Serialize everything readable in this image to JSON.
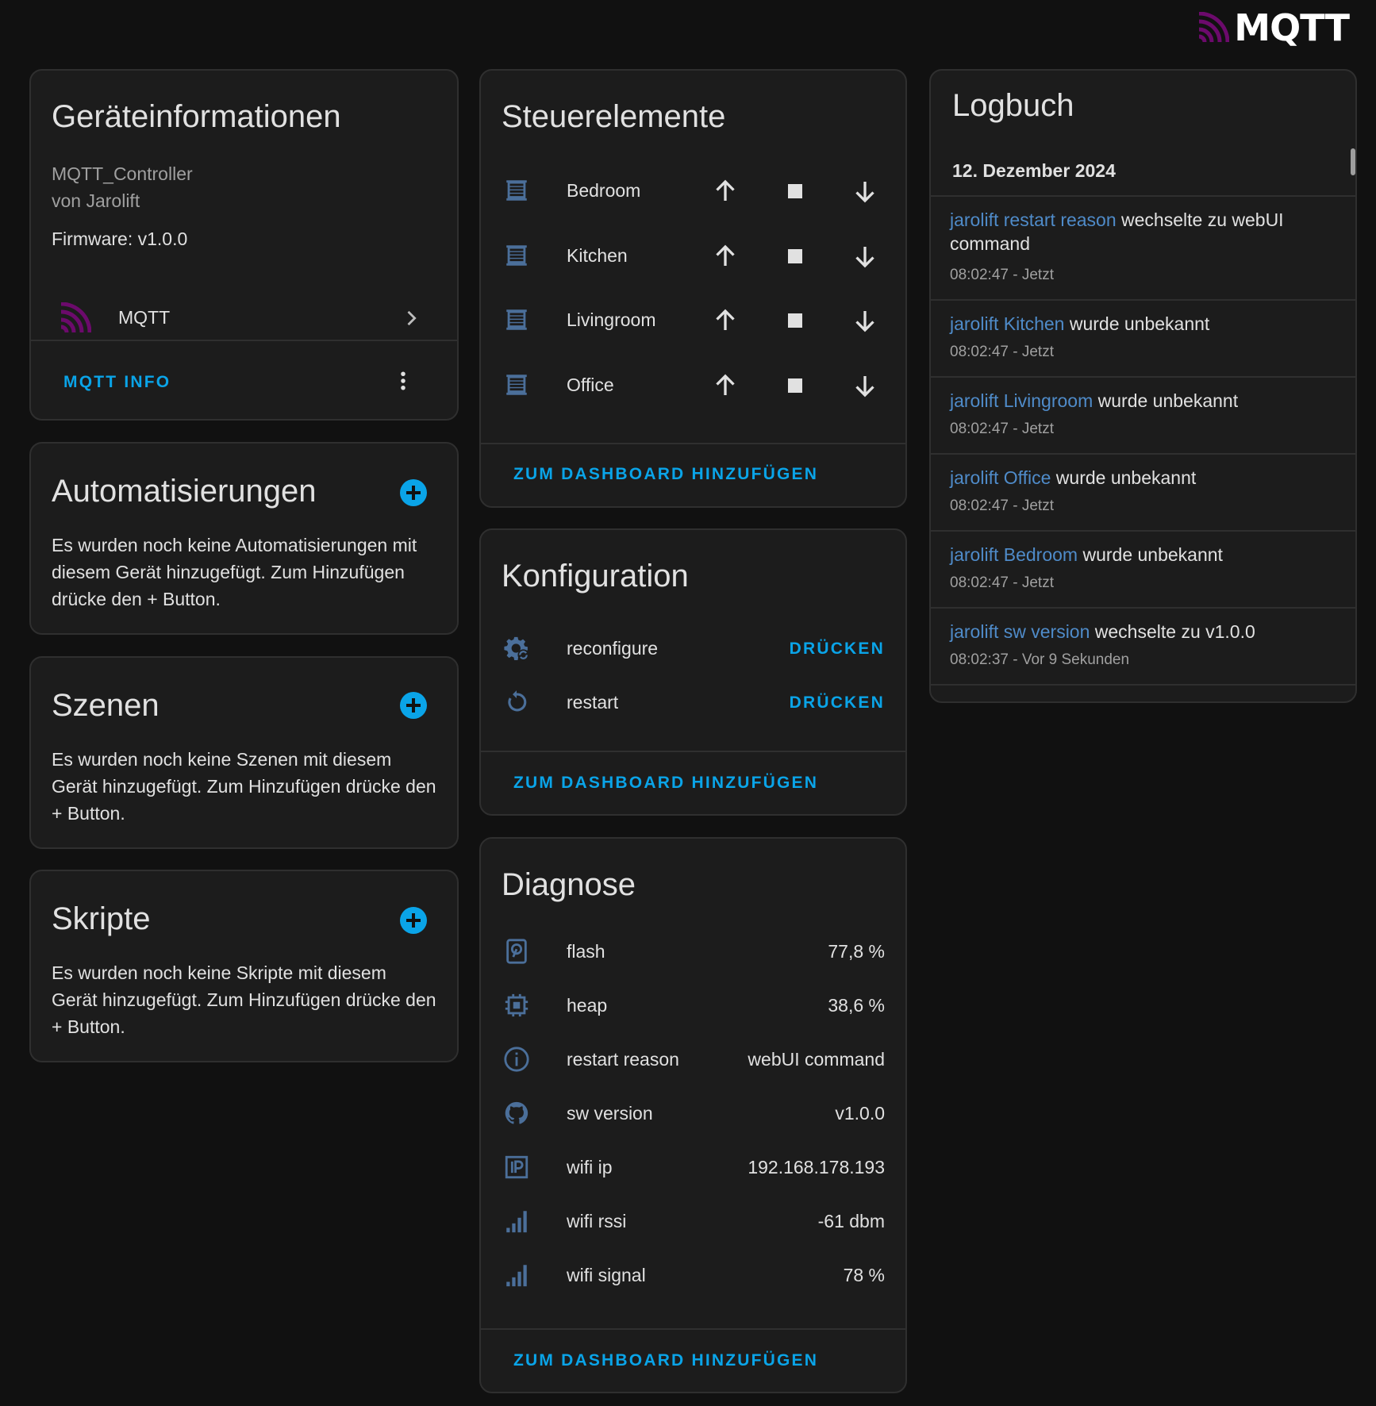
{
  "brand": {
    "name": "MQTT",
    "icon": "mqtt-logo-icon",
    "color": "#6c0a6c"
  },
  "accent_color": "#0aa4e8",
  "device_info": {
    "title": "Geräteinformationen",
    "model": "MQTT_Controller",
    "manufacturer": "von Jarolift",
    "firmware": "Firmware: v1.0.0",
    "integration": "MQTT",
    "integration_icon": "mqtt-logo-icon",
    "action_label": "MQTT INFO",
    "more_icon": "dots-vertical-icon"
  },
  "automations": {
    "title": "Automatisierungen",
    "text": "Es wurden noch keine Automatisierungen mit diesem Gerät hinzugefügt. Zum Hinzufügen drücke den + Button."
  },
  "scenes": {
    "title": "Szenen",
    "text": "Es wurden noch keine Szenen mit diesem Gerät hinzugefügt. Zum Hinzufügen drücke den + Button."
  },
  "scripts": {
    "title": "Skripte",
    "text": "Es wurden noch keine Skripte mit diesem Gerät hinzugefügt. Zum Hinzufügen drücke den + Button."
  },
  "controls": {
    "title": "Steuerelemente",
    "items": [
      {
        "name": "Bedroom",
        "icon": "blinds-icon"
      },
      {
        "name": "Kitchen",
        "icon": "blinds-icon"
      },
      {
        "name": "Livingroom",
        "icon": "blinds-icon"
      },
      {
        "name": "Office",
        "icon": "blinds-icon"
      }
    ],
    "add_label": "ZUM DASHBOARD HINZUFÜGEN"
  },
  "configuration": {
    "title": "Konfiguration",
    "items": [
      {
        "name": "reconfigure",
        "icon": "cog-sync-icon",
        "action": "DRÜCKEN"
      },
      {
        "name": "restart",
        "icon": "restart-icon",
        "action": "DRÜCKEN"
      }
    ],
    "add_label": "ZUM DASHBOARD HINZUFÜGEN"
  },
  "diagnostics": {
    "title": "Diagnose",
    "items": [
      {
        "name": "flash",
        "value": "77,8 %",
        "icon": "harddisk-icon"
      },
      {
        "name": "heap",
        "value": "38,6 %",
        "icon": "chip-icon"
      },
      {
        "name": "restart reason",
        "value": "webUI command",
        "icon": "information-icon"
      },
      {
        "name": "sw version",
        "value": "v1.0.0",
        "icon": "github-icon"
      },
      {
        "name": "wifi ip",
        "value": "192.168.178.193",
        "icon": "ip-icon"
      },
      {
        "name": "wifi rssi",
        "value": "-61 dbm",
        "icon": "signal-icon"
      },
      {
        "name": "wifi signal",
        "value": "78 %",
        "icon": "signal-icon"
      }
    ],
    "add_label": "ZUM DASHBOARD HINZUFÜGEN"
  },
  "logbook": {
    "title": "Logbuch",
    "date": "12. Dezember 2024",
    "entries": [
      {
        "entity": "jarolift restart reason",
        "message": " wechselte zu webUI command",
        "time": "08:02:47 - Jetzt"
      },
      {
        "entity": "jarolift Kitchen",
        "message": " wurde unbekannt",
        "time": "08:02:47 - Jetzt"
      },
      {
        "entity": "jarolift Livingroom",
        "message": " wurde unbekannt",
        "time": "08:02:47 - Jetzt"
      },
      {
        "entity": "jarolift Office",
        "message": " wurde unbekannt",
        "time": "08:02:47 - Jetzt"
      },
      {
        "entity": "jarolift Bedroom",
        "message": " wurde unbekannt",
        "time": "08:02:47 - Jetzt"
      },
      {
        "entity": "jarolift sw version",
        "message": " wechselte zu v1.0.0",
        "time": "08:02:37 - Vor 9 Sekunden"
      }
    ]
  }
}
